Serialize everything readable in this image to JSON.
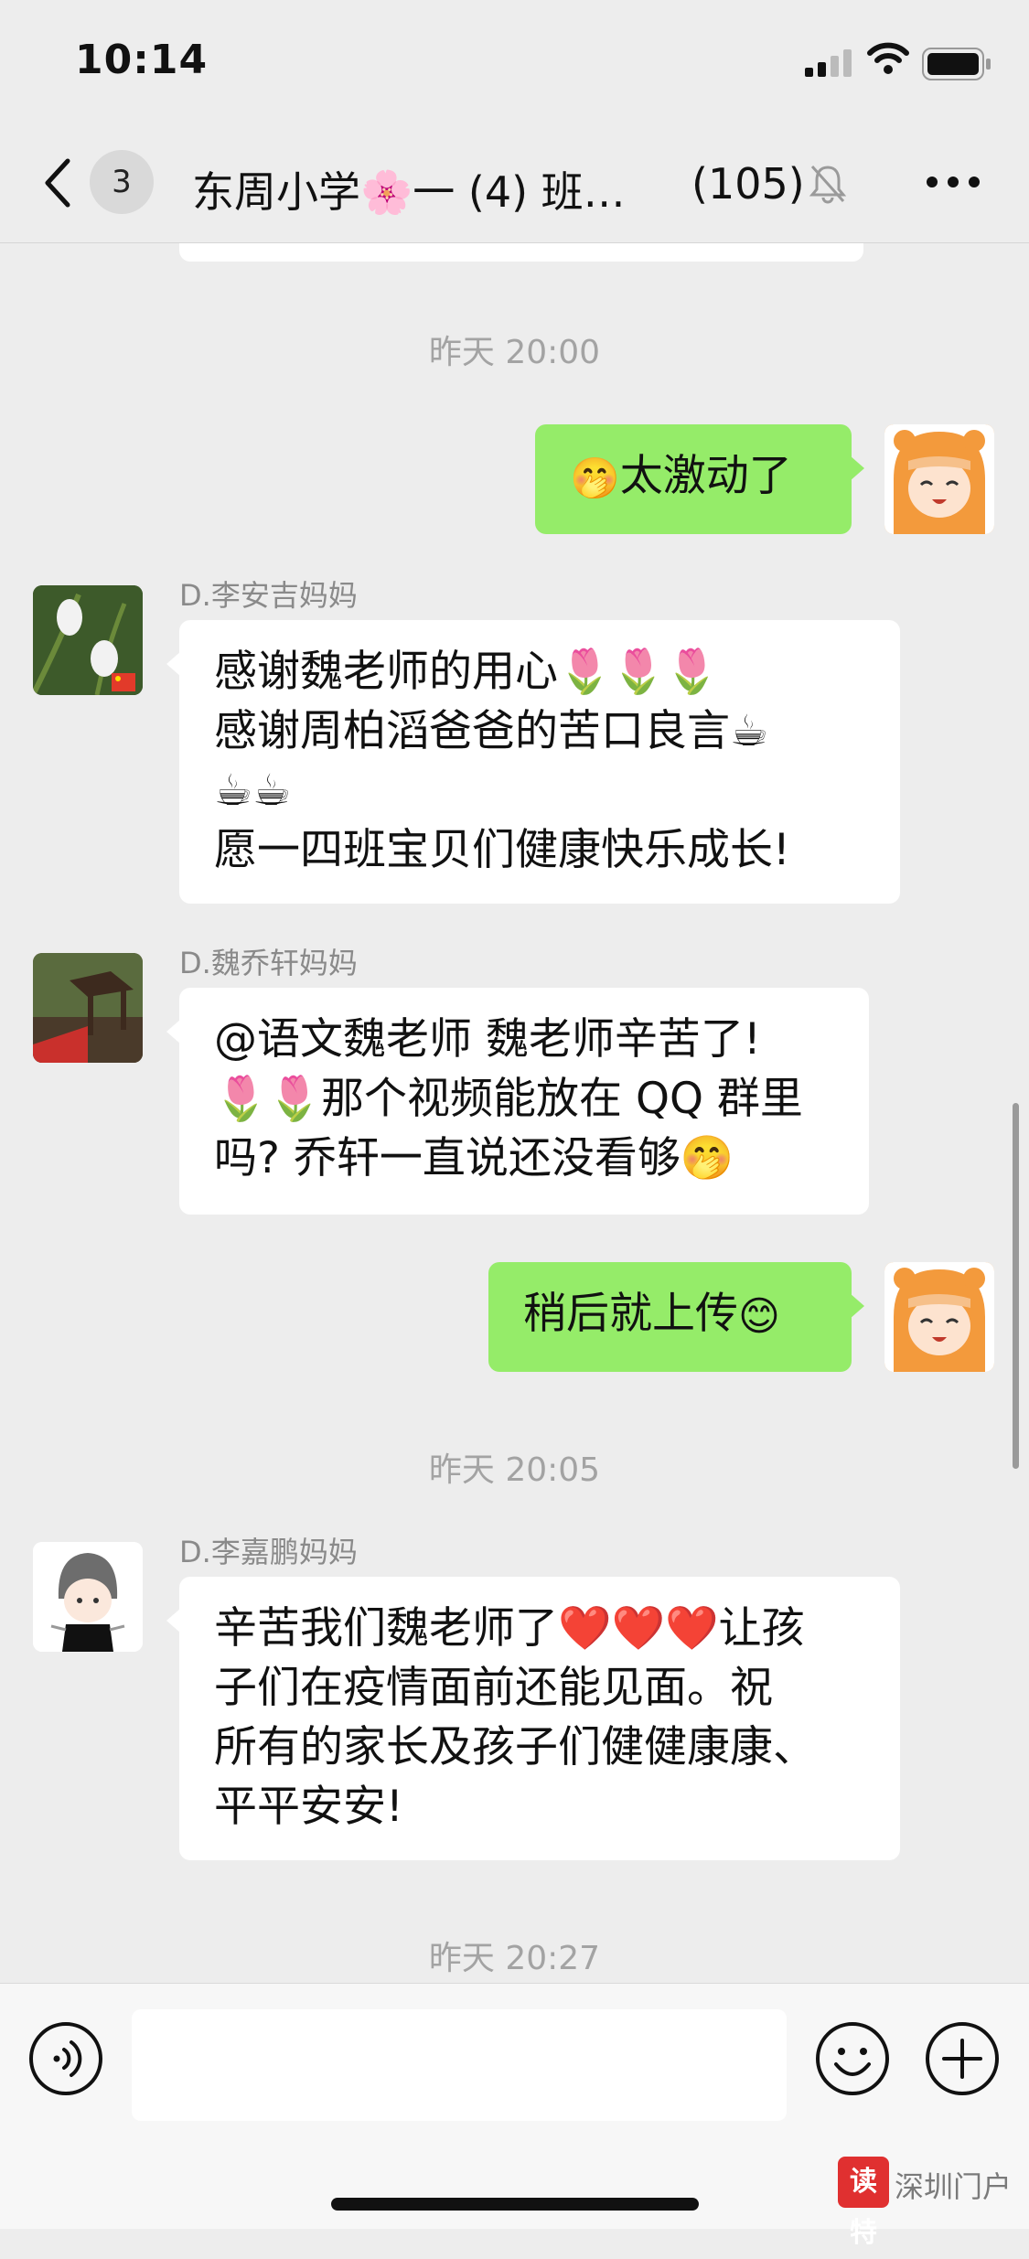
{
  "status": {
    "time": "10:14"
  },
  "nav": {
    "unread": "3",
    "title": "东周小学🌸一 (4) 班…",
    "member_count": "(105)"
  },
  "chat": {
    "timestamps": [
      "昨天 20:00",
      "昨天 20:05",
      "昨天 20:27"
    ],
    "messages": [
      {
        "direction": "out",
        "text": "太激动了",
        "emoji_before": "🤭"
      },
      {
        "direction": "in",
        "sender": "D.李安吉妈妈",
        "lines": [
          "感谢魏老师的用心🌷🌷🌷",
          "感谢周柏滔爸爸的苦口良言☕",
          "☕☕",
          "愿一四班宝贝们健康快乐成长!"
        ]
      },
      {
        "direction": "in",
        "sender": "D.魏乔轩妈妈",
        "lines": [
          "@语文魏老师 魏老师辛苦了!",
          "🌷🌷那个视频能放在 QQ 群里",
          "吗? 乔轩一直说还没看够🤭"
        ]
      },
      {
        "direction": "out",
        "text": "稍后就上传",
        "emoji_after": "😊"
      },
      {
        "direction": "in",
        "sender": "D.李嘉鹏妈妈",
        "lines": [
          "辛苦我们魏老师了❤️❤️❤️让孩",
          "子们在疫情面前还能见面。祝",
          "所有的家长及孩子们健健康康、",
          "平平安安!"
        ]
      }
    ]
  },
  "input": {
    "value": "",
    "placeholder": ""
  },
  "watermark": {
    "logo": "读特",
    "text": "深圳门户"
  },
  "colors": {
    "bubble_out": "#95ec69",
    "bubble_in": "#ffffff",
    "background": "#ededed"
  }
}
